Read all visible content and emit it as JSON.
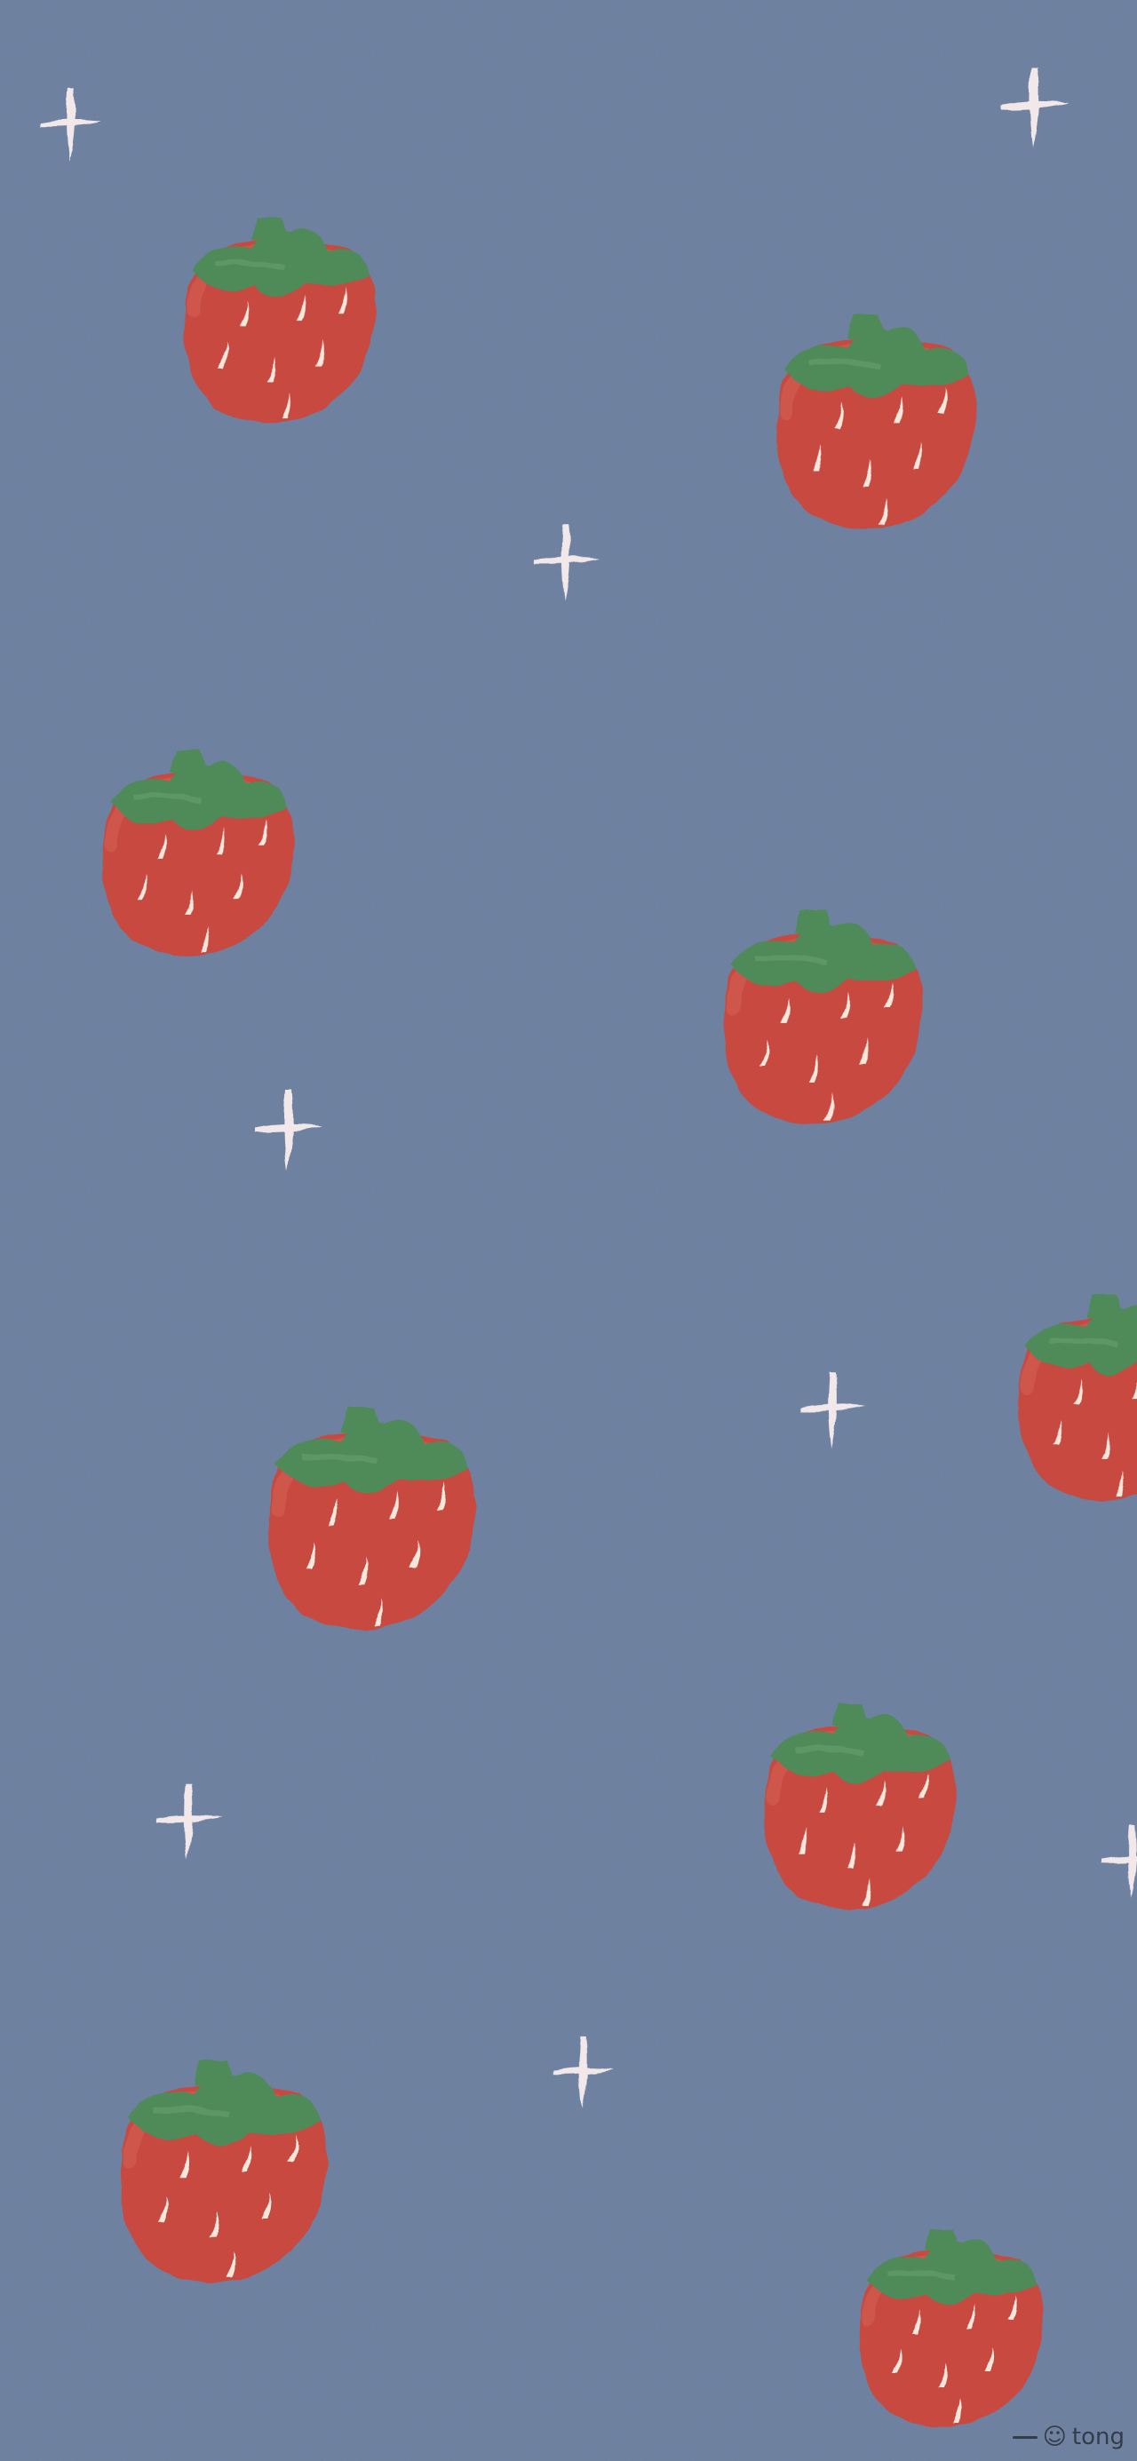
{
  "wallpaper": {
    "background_color": "#6b7f9f",
    "berry_color": "#c74a41",
    "leaf_color": "#4f8b58",
    "seed_color": "#f4e7dc",
    "sparkle_color": "#f2e8ea"
  },
  "signature": {
    "text": "tong"
  }
}
